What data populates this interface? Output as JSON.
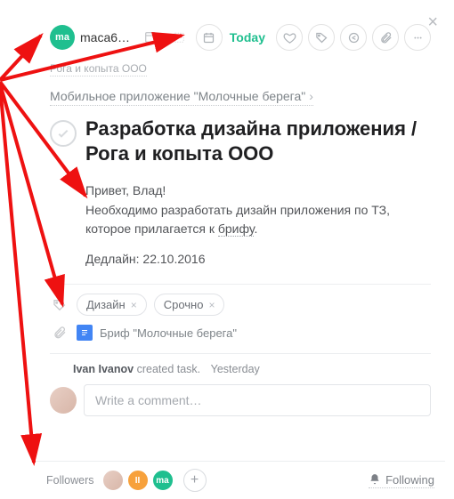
{
  "header": {
    "assignee_initials": "ma",
    "assignee_name": "maca611…",
    "date_label": "Today"
  },
  "org": "Рога и копыта ООО",
  "project": "Мобильное приложение \"Молочные берега\"",
  "title": "Разработка дизайна приложения / Рога и копыта ООО",
  "body": {
    "greeting": "Привет, Влад!",
    "line1a": "Необходимо разработать дизайн приложения по ТЗ, которое прилагается к ",
    "line1b": "брифу",
    "line1c": ".",
    "deadline": "Дедлайн: 22.10.2016"
  },
  "tags": [
    "Дизайн",
    "Срочно"
  ],
  "attachment": "Бриф \"Молочные берега\"",
  "activity": {
    "who": "Ivan Ivanov",
    "what": "created task.",
    "when": "Yesterday"
  },
  "comment_placeholder": "Write a comment…",
  "footer": {
    "followers_label": "Followers",
    "following_label": "Following",
    "avatars": {
      "1": "II",
      "2": "ma"
    }
  }
}
